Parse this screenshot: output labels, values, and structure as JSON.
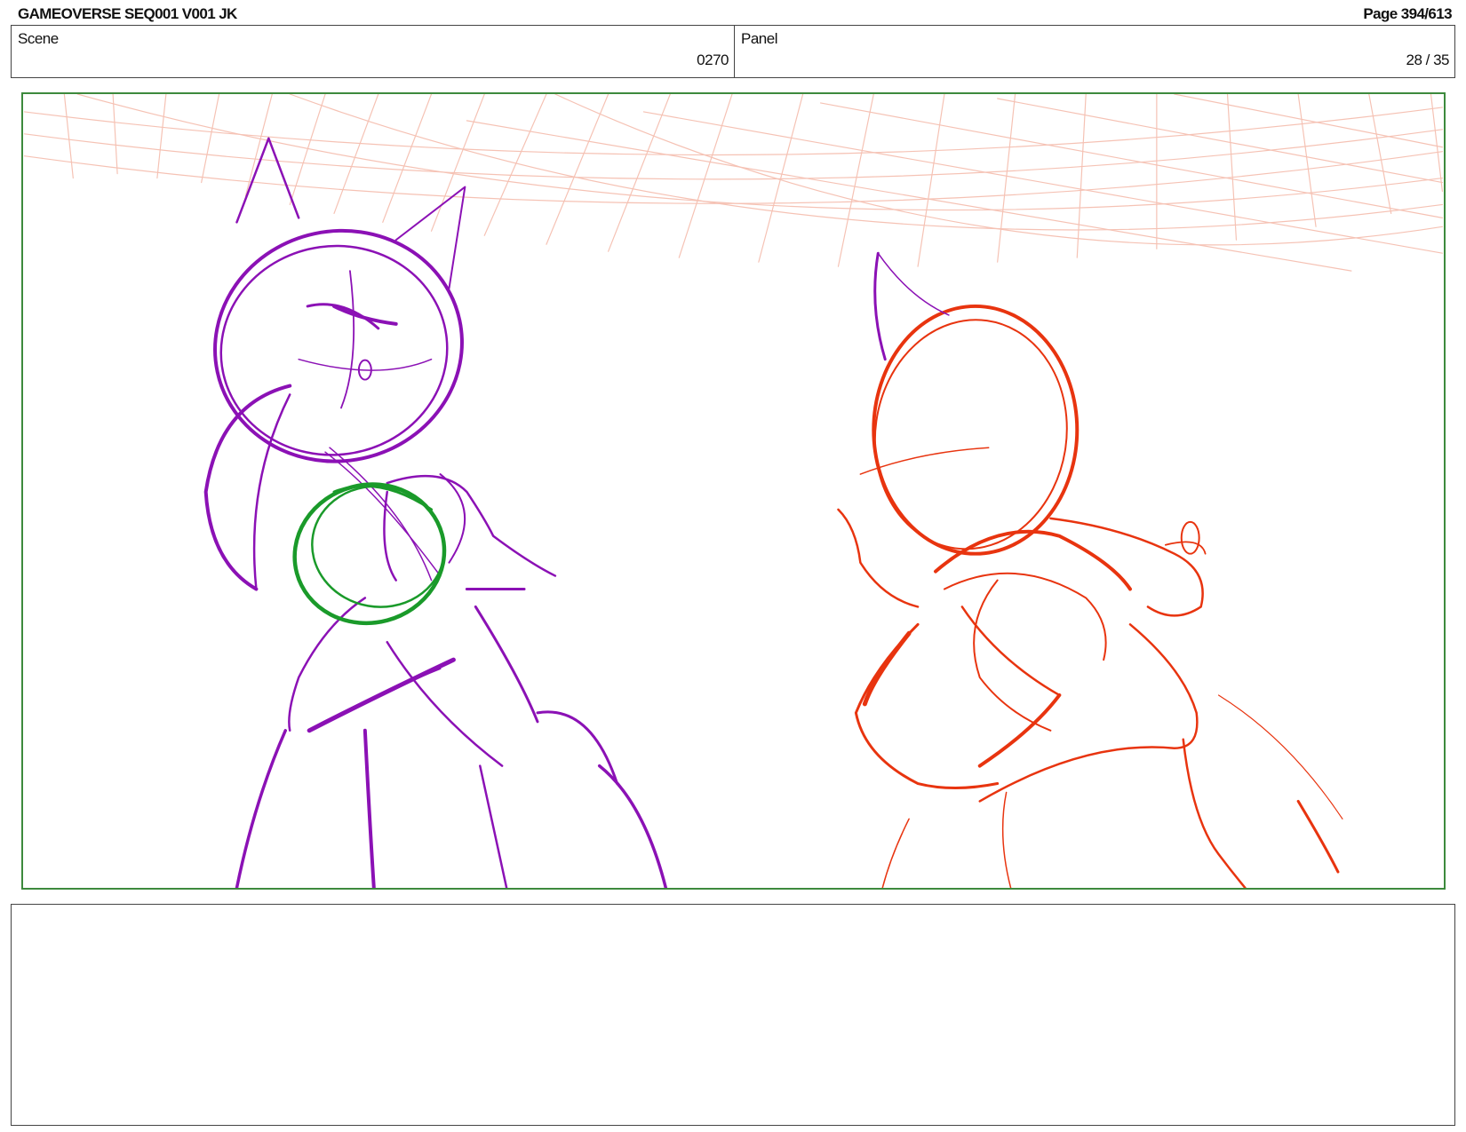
{
  "header": {
    "title": "GAMEOVERSE SEQ001 V001 JK",
    "page": "Page 394/613"
  },
  "info": {
    "scene_label": "Scene",
    "scene_value": "0270",
    "panel_label": "Panel",
    "panel_value": "28 / 35"
  },
  "panel_image": {
    "description_colors": {
      "frame": "#3d8a3d",
      "character_left": "#8b11b5",
      "character_left_accent": "#1a9a2a",
      "character_right": "#e8340f",
      "background_grid": "#f4b8a8"
    }
  },
  "notes": {
    "text": ""
  }
}
